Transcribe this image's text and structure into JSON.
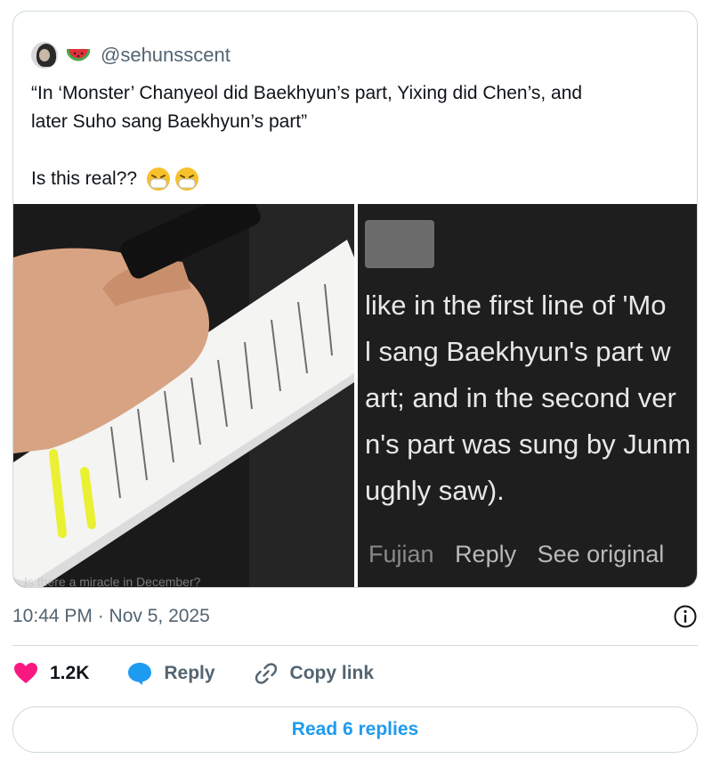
{
  "quoted_post": {
    "handle": "@sehunsscent",
    "text_line1": "“In ‘Monster’ Chanyeol did Baekhyun’s part, Yixing did Chen’s, and",
    "text_line2": "later Suho sang Baekhyun’s part”",
    "text_line3": "Is this real??",
    "emojis": [
      "sneezing-face-emoji",
      "sneezing-face-emoji"
    ],
    "media_left": {
      "icon": "photo-script-pages",
      "caption": "Is there a miracle in December?"
    },
    "media_right": {
      "comment_lines": [
        "like in the first line of 'Mo",
        "l sang Baekhyun's part w",
        "art; and in the second ver",
        "n's part was sung by Junm",
        "ughly saw)."
      ],
      "location": "Fujian",
      "reply": "Reply",
      "see_original": "See original"
    }
  },
  "timestamp": "10:44 PM · Nov 5, 2025",
  "actions": {
    "likes": "1.2K",
    "reply": "Reply",
    "copy_link": "Copy link"
  },
  "read_replies": "Read 6 replies",
  "colors": {
    "like": "#f91880",
    "reply": "#1d9bf0",
    "accent": "#1d9bf0",
    "muted": "#536471",
    "border": "#cfd9de"
  }
}
